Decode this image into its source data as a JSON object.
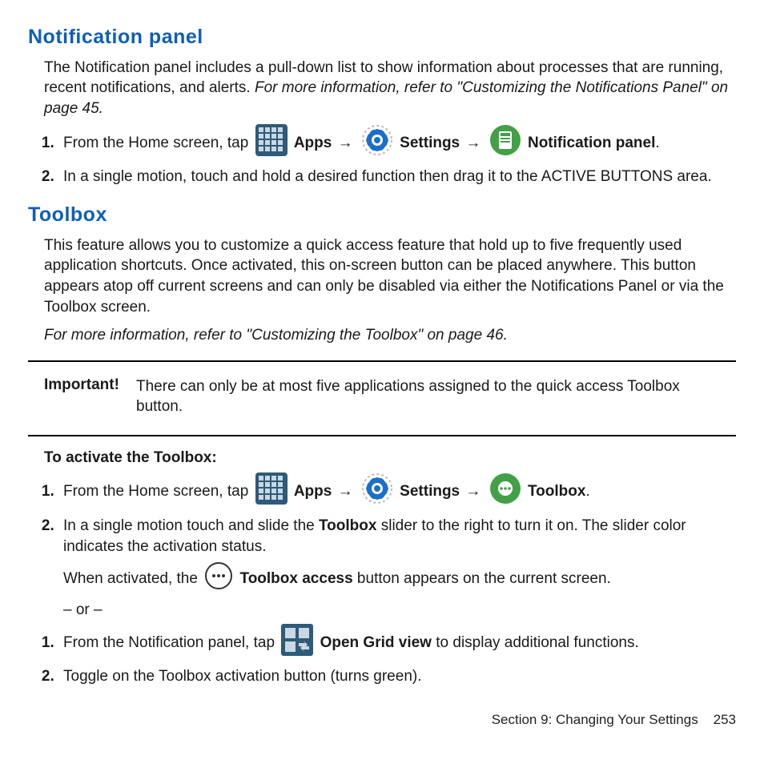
{
  "section1": {
    "heading": "Notification panel",
    "intro_plain": "The Notification panel includes a pull-down list to show information about processes that are running, recent notifications, and alerts. ",
    "intro_italic": "For more information, refer to \"Customizing the Notifications Panel\" on page 45.",
    "step1_a": "From the Home screen, tap ",
    "apps_label": "Apps",
    "settings_label": "Settings",
    "notif_label_a": "Notification",
    "notif_label_b": "panel",
    "step2": "In a single motion, touch and hold a desired function then drag it to the ACTIVE BUTTONS area."
  },
  "section2": {
    "heading": "Toolbox",
    "intro": "This feature allows you to customize a quick access feature that hold up to five frequently used application shortcuts. Once activated, this on-screen button can be placed anywhere. This button appears atop off current screens and can only be disabled via either the Notifications Panel or via the Toolbox screen.",
    "intro_ref": "For more information, refer to \"Customizing the Toolbox\" on page 46.",
    "important_label": "Important!",
    "important_text": "There can only be at most five applications assigned to the quick access Toolbox button.",
    "activate_heading": "To activate the Toolbox:",
    "step1_a": "From the Home screen, tap ",
    "apps_label": "Apps",
    "settings_label": "Settings",
    "toolbox_label": "Toolbox",
    "step2_a": "In a single motion touch and slide the ",
    "step2_b": "Toolbox",
    "step2_c": " slider to the right to turn it on. The slider color indicates the activation status.",
    "activated_a": "When activated, the ",
    "activated_b": "Toolbox access",
    "activated_c": " button appears on the current screen.",
    "or_text": "– or –",
    "alt1_a": "From the Notification panel, tap ",
    "alt1_b": "Open Grid view",
    "alt1_c": " to display additional functions.",
    "alt2": "Toggle on the Toolbox activation button (turns green)."
  },
  "footer": {
    "section": "Section 9:  Changing Your Settings",
    "page": "253"
  },
  "arrow": "→"
}
